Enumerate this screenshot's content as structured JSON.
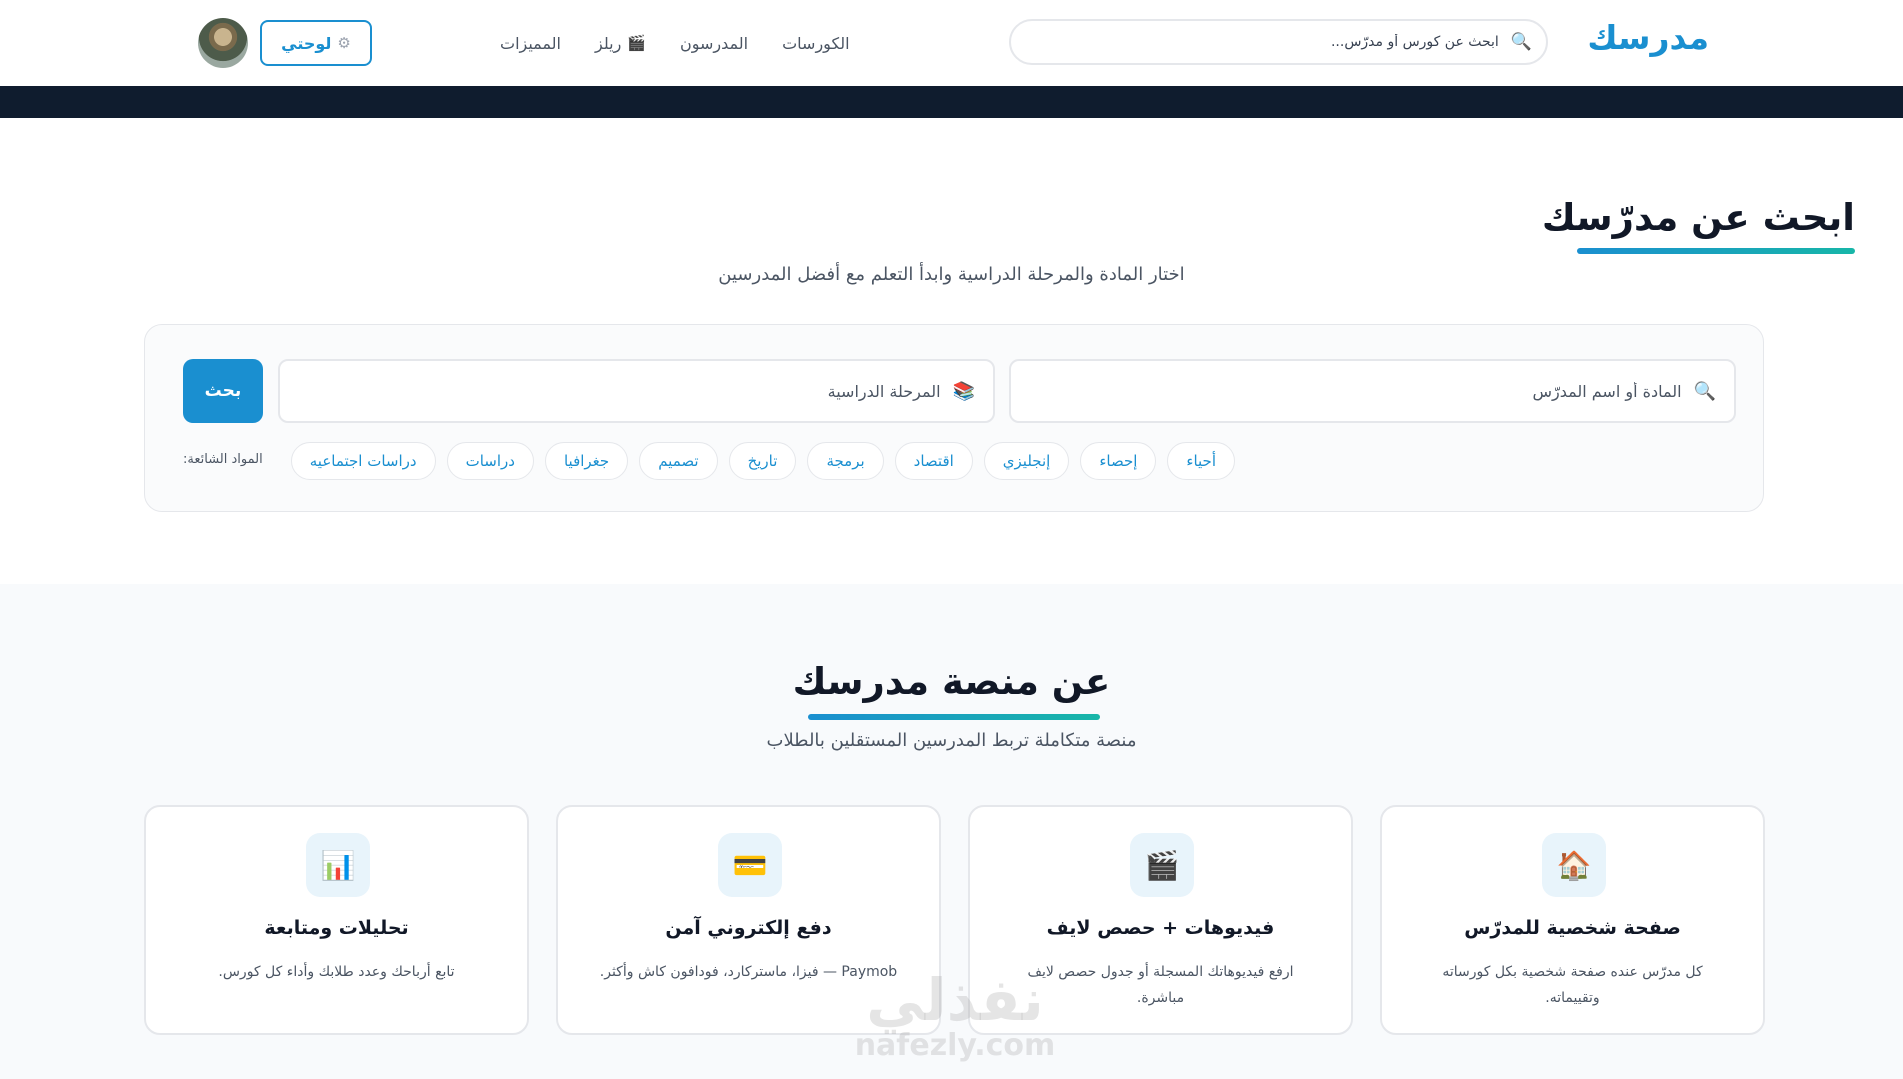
{
  "header": {
    "logo": "مدرسك",
    "search_placeholder": "ابحث عن كورس أو مدرّس...",
    "nav": [
      {
        "label": "الكورسات"
      },
      {
        "label": "المدرسون"
      },
      {
        "label": "ريلز"
      },
      {
        "label": "المميزات"
      }
    ],
    "dashboard_label": "لوحتي"
  },
  "hero": {
    "title": "ابحث عن مدرّسك",
    "subtitle": "اختار المادة والمرحلة الدراسية وابدأ التعلم مع أفضل المدرسين",
    "subject_placeholder": "المادة أو اسم المدرّس",
    "stage_placeholder": "المرحلة الدراسية",
    "search_label": "بحث",
    "tags_label": "المواد الشائعة:",
    "tags": [
      "أحياء",
      "إحصاء",
      "إنجليزي",
      "اقتصاد",
      "برمجة",
      "تاريخ",
      "تصميم",
      "جغرافيا",
      "دراسات",
      "دراسات اجتماعيه"
    ]
  },
  "about": {
    "title": "عن منصة مدرسك",
    "subtitle": "منصة متكاملة تربط المدرسين المستقلين بالطلاب",
    "cards": [
      {
        "icon": "house-icon",
        "title": "صفحة شخصية للمدرّس",
        "desc": "كل مدرّس عنده صفحة شخصية بكل كورساته وتقييماته."
      },
      {
        "icon": "clapper-icon",
        "title": "فيديوهات + حصص لايف",
        "desc": "ارفع فيديوهاتك المسجلة أو جدول حصص لايف مباشرة."
      },
      {
        "icon": "credit-card-icon",
        "title": "دفع إلكتروني آمن",
        "desc": "Paymob — فيزا، ماستركارد، فودافون كاش وأكثر."
      },
      {
        "icon": "bar-chart-icon",
        "title": "تحليلات ومتابعة",
        "desc": "تابع أرباحك وعدد طلابك وأداء كل كورس."
      }
    ]
  },
  "watermark": {
    "arabic": "نفذلي",
    "latin": "nafezly.com"
  },
  "colors": {
    "brand": "#1a8fd0",
    "accent": "#18b6a8",
    "dark_band": "#0f1c2e"
  }
}
